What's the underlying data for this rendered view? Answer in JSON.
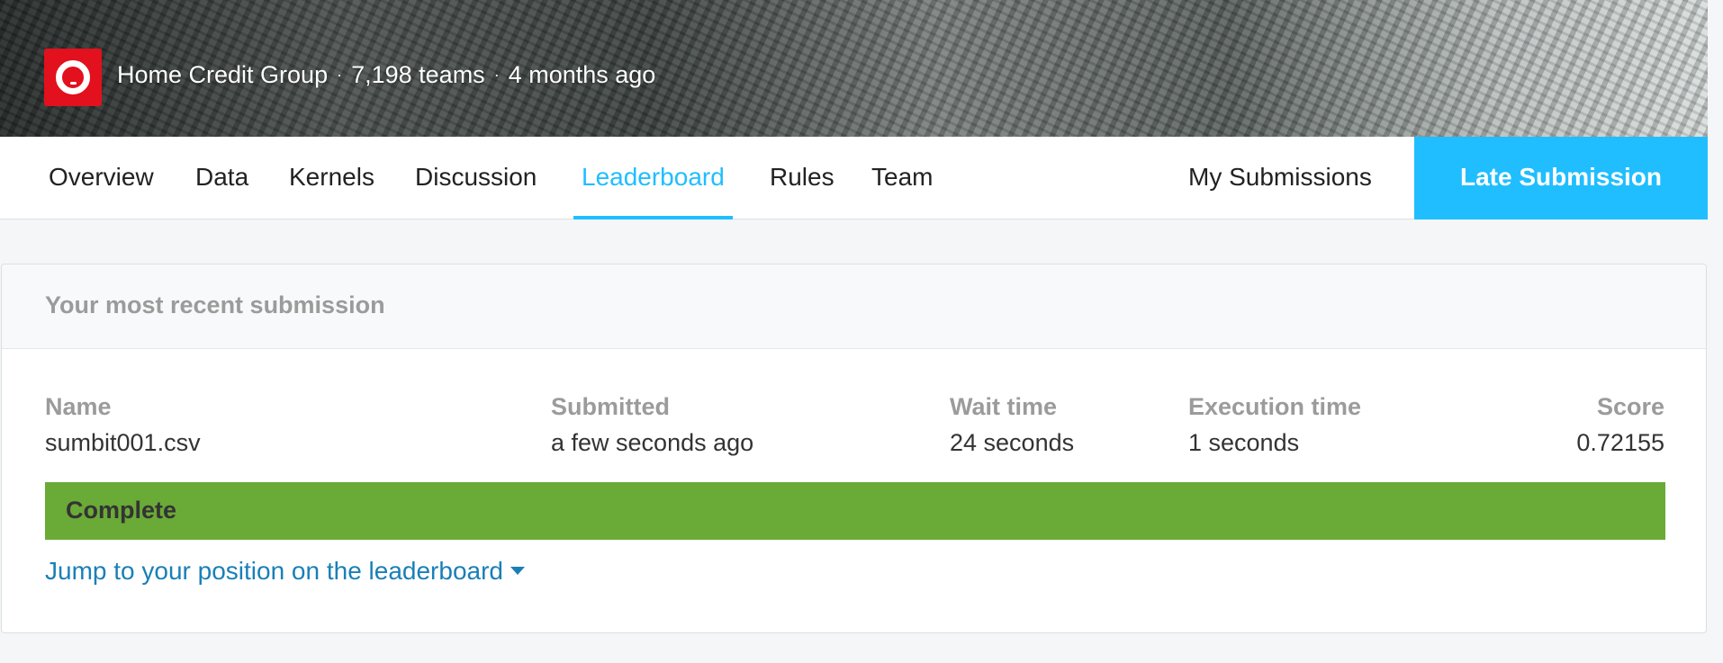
{
  "header": {
    "organization": "Home Credit Group",
    "separator": "·",
    "teams": "7,198 teams",
    "time_ago": "4 months ago",
    "logo_icon": "home-credit-logo-icon",
    "accent_color": "#20beff",
    "logo_color": "#e3101e"
  },
  "nav": {
    "tabs": [
      {
        "label": "Overview"
      },
      {
        "label": "Data"
      },
      {
        "label": "Kernels"
      },
      {
        "label": "Discussion"
      },
      {
        "label": "Leaderboard",
        "active": true
      },
      {
        "label": "Rules"
      },
      {
        "label": "Team"
      }
    ],
    "my_submissions": "My Submissions",
    "late_submission": "Late Submission"
  },
  "submission": {
    "title": "Your most recent submission",
    "columns": {
      "name": "Name",
      "submitted": "Submitted",
      "wait_time": "Wait time",
      "execution_time": "Execution time",
      "score": "Score"
    },
    "values": {
      "name": "sumbit001.csv",
      "submitted": "a few seconds ago",
      "wait_time": "24 seconds",
      "execution_time": "1 seconds",
      "score": "0.72155"
    },
    "status": "Complete",
    "status_color": "#6aaa37",
    "jump_link": "Jump to your position on the leaderboard",
    "jump_icon": "caret-down-icon"
  }
}
